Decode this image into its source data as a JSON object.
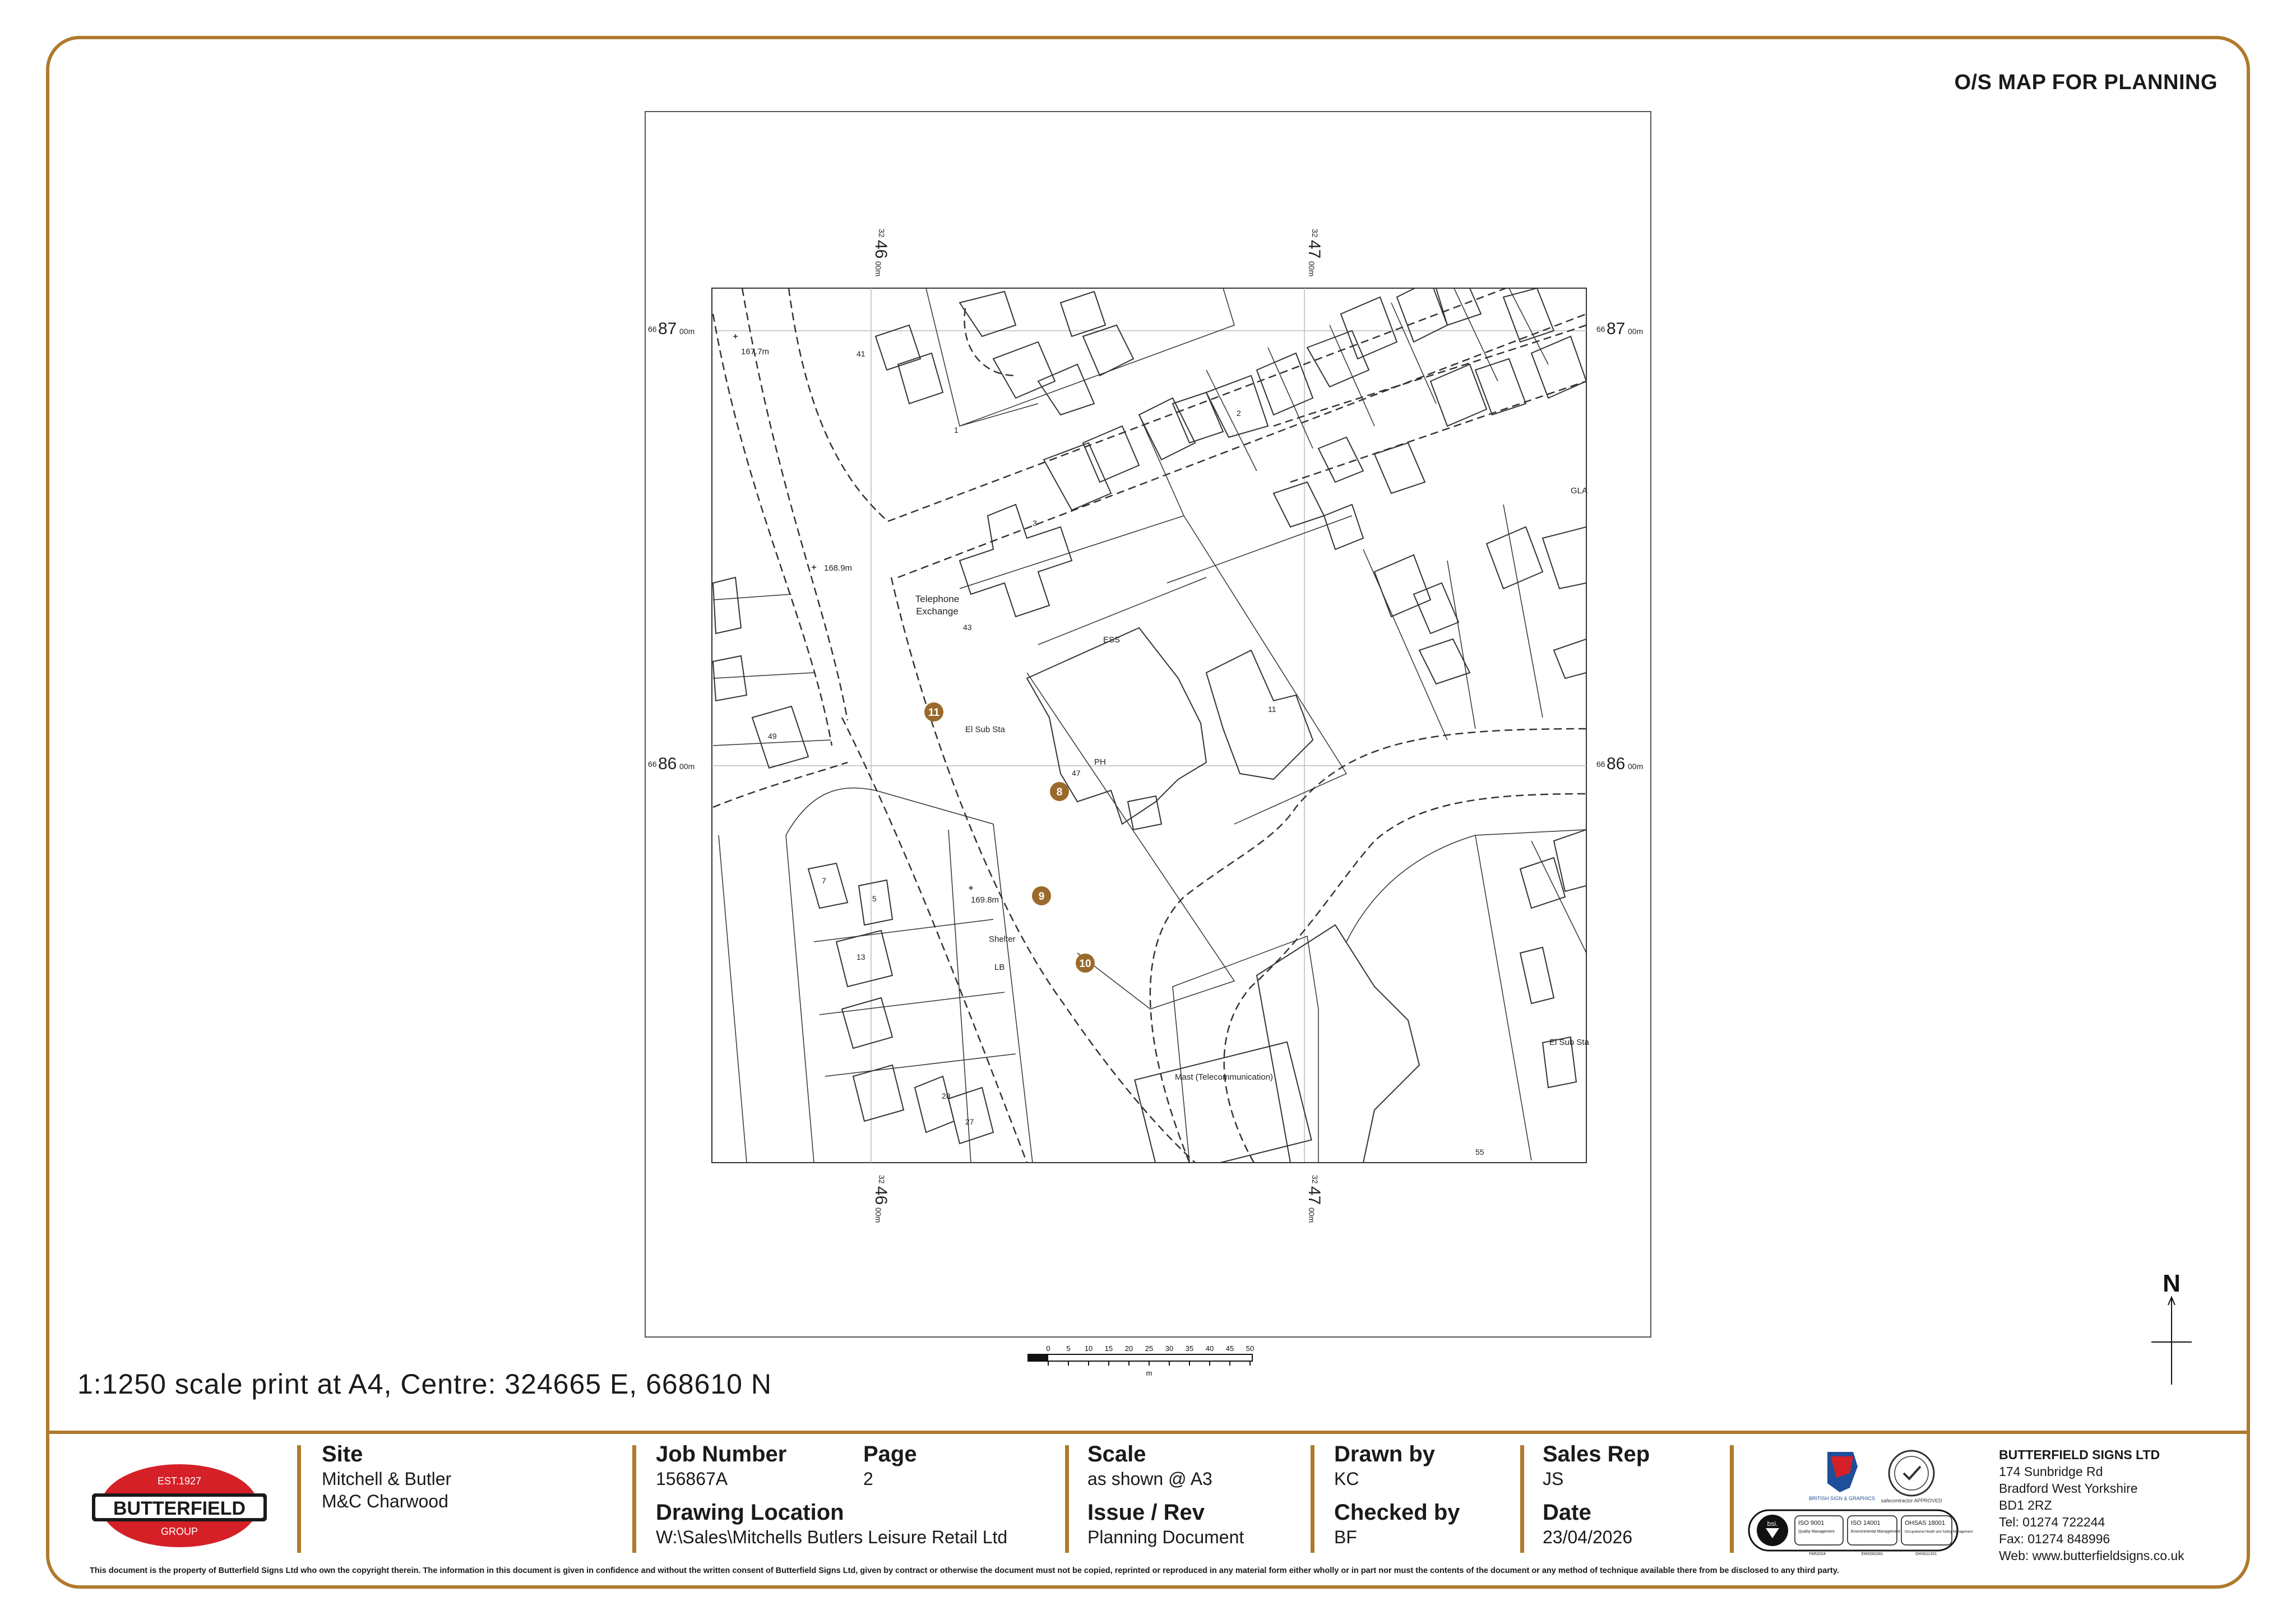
{
  "document": {
    "title": "O/S MAP FOR PLANNING",
    "scale_caption": "1:1250 scale print at A4, Centre: 324665 E, 668610 N",
    "disclaimer": "This document is the property of Butterfield Signs Ltd who own the copyright therein. The information in this document is given in confidence and without the written consent of Butterfield Signs Ltd, given by contract or otherwise the document must not be copied, reprinted or reproduced in any material form either wholly or in part nor must the contents of the document or any method of technique available there from be disclosed to any third party."
  },
  "map": {
    "grid": {
      "easting_left": {
        "prefix": "32",
        "major": "46",
        "suffix": "00m"
      },
      "easting_right": {
        "prefix": "32",
        "major": "47",
        "suffix": "00m"
      },
      "northing_top": {
        "prefix": "66",
        "major": "87",
        "suffix": "00m"
      },
      "northing_bottom": {
        "prefix": "66",
        "major": "86",
        "suffix": "00m"
      }
    },
    "labels": {
      "telephone_exchange_1": "Telephone",
      "telephone_exchange_2": "Exchange",
      "el_sub_sta_1": "El Sub Sta",
      "el_sub_sta_2": "El Sub Sta",
      "ess": "ESS",
      "ph": "PH",
      "shelter": "Shelter",
      "lb": "LB",
      "mast": "Mast (Telecommunication)",
      "spot_1": "167.7m",
      "spot_2": "168.9m",
      "spot_3": "169.8m",
      "road_fragment": "GLA",
      "house_41": "41",
      "house_43": "43",
      "house_47": "47",
      "house_1": "1",
      "house_2": "2",
      "house_3": "3",
      "house_5": "5",
      "house_7": "7",
      "house_11": "11",
      "house_27": "27",
      "house_28": "28",
      "house_49": "49",
      "house_55": "55",
      "house_13": "13"
    },
    "markers": [
      "8",
      "9",
      "10",
      "11"
    ],
    "marker_color": "#9a6a2c"
  },
  "scalebar": {
    "ticks": [
      "0",
      "5",
      "10",
      "15",
      "20",
      "25",
      "30",
      "35",
      "40",
      "45",
      "50"
    ],
    "unit": "m"
  },
  "north": {
    "label": "N"
  },
  "titleblock": {
    "site_label": "Site",
    "site_line1": "Mitchell & Butler",
    "site_line2": "M&C Charwood",
    "job_label": "Job Number",
    "job_value": "156867A",
    "page_label": "Page",
    "page_value": "2",
    "drawing_location_label": "Drawing Location",
    "drawing_location_value": "W:\\Sales\\Mitchells Butlers Leisure Retail Ltd",
    "scale_label": "Scale",
    "scale_value": "as shown @ A3",
    "issue_label": "Issue / Rev",
    "issue_value": "Planning Document",
    "drawn_label": "Drawn by",
    "drawn_value": "KC",
    "checked_label": "Checked by",
    "checked_value": "BF",
    "salesrep_label": "Sales Rep",
    "salesrep_value": "JS",
    "date_label": "Date",
    "date_value": "23/04/2026"
  },
  "logo": {
    "established": "EST.1927",
    "name": "BUTTERFIELD",
    "group": "GROUP",
    "red": "#d52027",
    "black": "#1a1a1a"
  },
  "certifications": {
    "bsgd": "BRITISH SIGN & GRAPHICS",
    "safecontractor": "safecontractor APPROVED",
    "bsi": "bsi.",
    "iso9001": "ISO 9001",
    "iso9001_sub": "Quality Management",
    "iso14001": "ISO 14001",
    "iso14001_sub": "Environmental Management",
    "ohsas": "OHSAS 18001",
    "ohsas_sub": "Occupational Health and Safety Management",
    "cert1": "FM52024",
    "cert2": "EMS560281",
    "cert3": "OHS611201"
  },
  "company": {
    "name": "BUTTERFIELD SIGNS LTD",
    "addr1": "174 Sunbridge Rd",
    "addr2": "Bradford West Yorkshire",
    "addr3": "BD1 2RZ",
    "tel": "Tel: 01274 722244",
    "fax": "Fax: 01274 848996",
    "web": "Web: www.butterfieldsigns.co.uk"
  },
  "colors": {
    "accent": "#b07a2c",
    "map_line": "#333333"
  }
}
